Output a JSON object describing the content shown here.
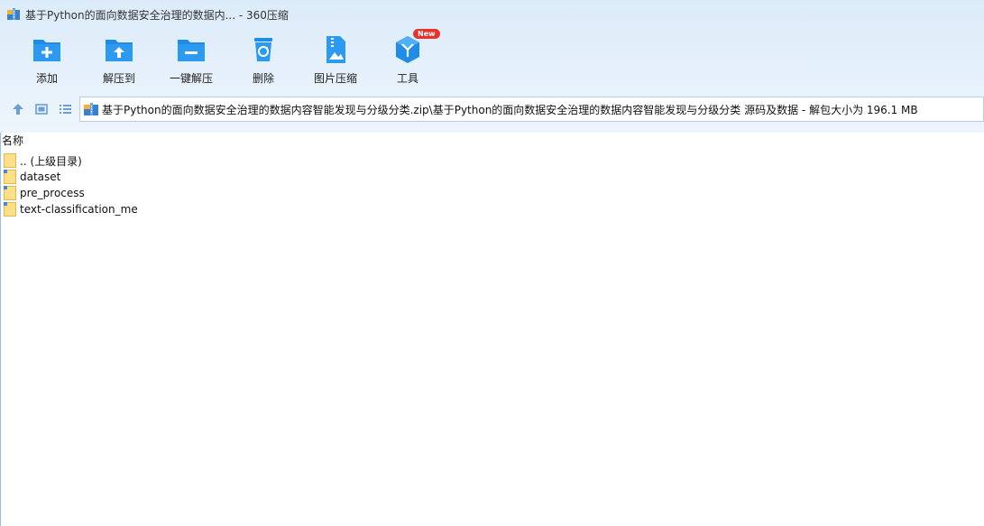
{
  "window": {
    "title": "基于Python的面向数据安全治理的数据内... - 360压缩"
  },
  "toolbar": {
    "add_label": "添加",
    "extract_to_label": "解压到",
    "one_click_extract_label": "一键解压",
    "delete_label": "删除",
    "image_compress_label": "图片压缩",
    "tools_label": "工具",
    "tools_badge": "New"
  },
  "address": {
    "path": "基于Python的面向数据安全治理的数据内容智能发现与分级分类.zip\\基于Python的面向数据安全治理的数据内容智能发现与分级分类 源码及数据 - 解包大小为 196.1 MB"
  },
  "list": {
    "column_name": "名称",
    "items": [
      {
        "name": ".. (上级目录)",
        "icon": "folder-up-icon"
      },
      {
        "name": "dataset",
        "icon": "folder-icon"
      },
      {
        "name": "pre_process",
        "icon": "folder-icon"
      },
      {
        "name": "text-classification_me",
        "icon": "folder-icon"
      }
    ]
  },
  "colors": {
    "accent": "#1f8ce6",
    "chrome_bg": "#dcebf9",
    "badge": "#e8332d"
  }
}
